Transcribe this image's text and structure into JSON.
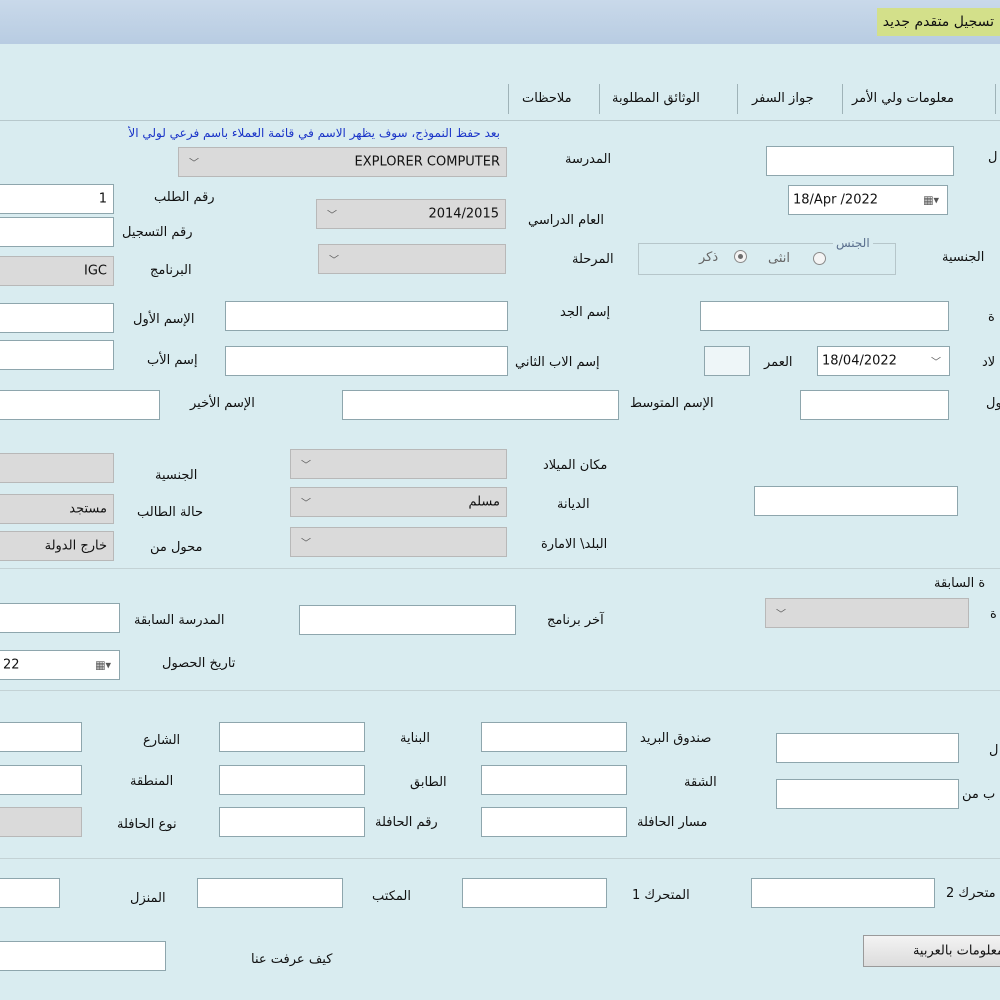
{
  "window": {
    "title": "تسجيل متقدم جديد"
  },
  "tabs": [
    "معلومات ولي الأمر",
    "جواز السفر",
    "الوثائق المطلوبة",
    "ملاحظات"
  ],
  "info_message": "بعد حفظ النموذج، سوف يظهر الاسم في قائمة العملاء باسم فرعي لولي الأ",
  "labels": {
    "school": "المدرسة",
    "request_no": "رقم الطلب",
    "academic_year": "العام الدراسي",
    "registration_no": "رقم التسجيل",
    "stage": "المرحلة",
    "program": "البرنامج",
    "gender": "الجنس",
    "female": "انثى",
    "male": "ذكر",
    "grandfather_name": "إسم الجد",
    "first_name": "الإسم الأول",
    "second_father_name": "إسم الاب الثاني",
    "father_name": "إسم الأب",
    "age": "العمر",
    "middle_name": "الإسم المتوسط",
    "last_name": "الإسم الأخير",
    "birthplace": "مكان الميلاد",
    "nationality": "الجنسية",
    "religion": "الديانة",
    "student_status": "حالة الطالب",
    "country_emirate": "البلد\\ الامارة",
    "transferred_from": "محول من",
    "previous_section": "ة السابقة",
    "last_program": "آخر برنامج",
    "previous_school": "المدرسة السابقة",
    "obtain_date": "تاريخ الحصول",
    "po_box": "صندوق البريد",
    "building": "البناية",
    "street": "الشارع",
    "apartment": "الشقة",
    "floor": "الطابق",
    "area": "المنطقة",
    "bus_route": "مسار الحافلة",
    "bus_number": "رقم الحافلة",
    "bus_type": "نوع الحافلة",
    "mobile2": "متحرك 2",
    "mobile1": "المتحرك 1",
    "office": "المكتب",
    "home": "المنزل",
    "how_found": "كيف عرفت عنا",
    "edge_l": "ل",
    "edge_nationality": "الجنسية",
    "edge_h": "ة",
    "edge_birth": "لاد",
    "edge_first": "ول",
    "edge_h2": "ة",
    "edge_l2": "ل",
    "edge_from": "ب من"
  },
  "values": {
    "school": "EXPLORER COMPUTER",
    "request_no": "1",
    "registration_date": "18/Apr /2022",
    "academic_year": "2014/2015",
    "program": "IGC",
    "birth_date": "18/04/2022",
    "religion": "مسلم",
    "student_status": "مستجد",
    "transferred_from": "خارج الدولة",
    "obtain_date": "22"
  },
  "buttons": {
    "arabic_info": "معلومات بالعربية"
  },
  "icons": {
    "calendar": "calendar-dropdown-icon",
    "chevron": "chevron-down-icon"
  },
  "colors": {
    "background": "#d9ecf0",
    "title_highlight": "#d3e08a",
    "info_text": "#1b35c8"
  }
}
